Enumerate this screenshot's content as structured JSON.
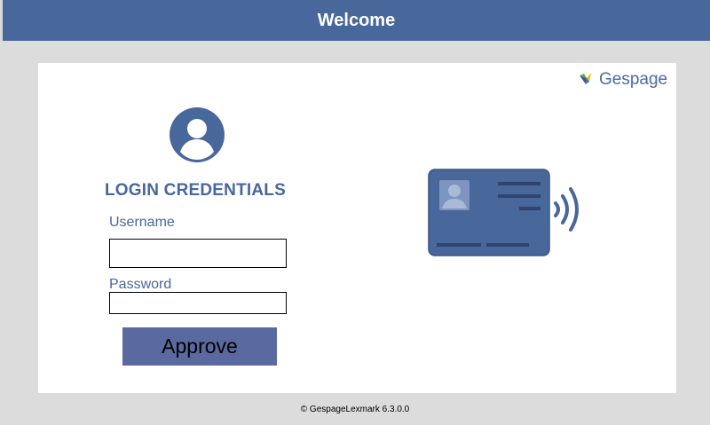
{
  "header": {
    "title": "Welcome"
  },
  "brand": {
    "name": "Gespage"
  },
  "login": {
    "title": "LOGIN CREDENTIALS",
    "username_label": "Username",
    "password_label": "Password",
    "username_value": "",
    "password_value": "",
    "approve_label": "Approve"
  },
  "footer": {
    "text": "© GespageLexmark 6.3.0.0"
  },
  "colors": {
    "header_bg": "#48679a",
    "accent": "#48679a",
    "button_bg": "#5a6aa0",
    "card_bg": "#48679a",
    "page_bg": "#dcdcdc"
  },
  "icons": {
    "avatar": "user-avatar-icon",
    "card": "contactless-id-card-icon",
    "logo": "gespage-logo-icon"
  }
}
